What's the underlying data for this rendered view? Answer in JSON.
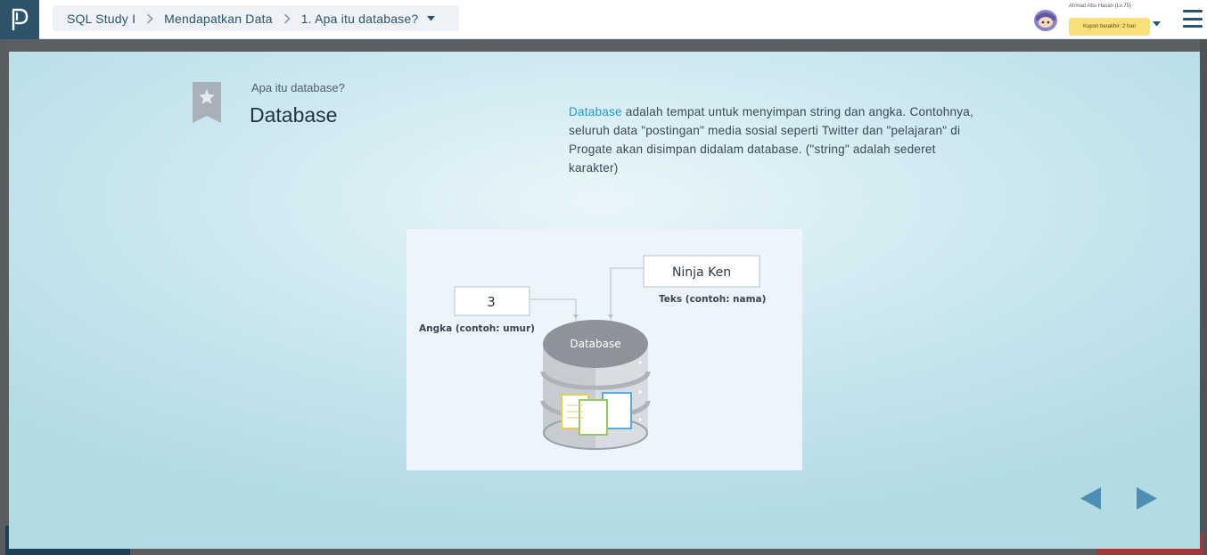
{
  "header": {
    "breadcrumb": [
      "SQL Study I",
      "Mendapatkan Data",
      "1. Apa itu database?"
    ],
    "user_name": "Ahmad Abu Hasan (Lv.75)",
    "coupon": "Kupon berakhir: 2 hari"
  },
  "slide": {
    "subtitle": "Apa itu database?",
    "title": "Database",
    "description_keyword": "Database",
    "description_rest": " adalah tempat untuk menyimpan string dan angka. Contohnya, seluruh data \"postingan\" media sosial seperti Twitter dan \"pelajaran\" di Progate akan disimpan didalam database. (\"string\" adalah sederet karakter)",
    "figure": {
      "number_value": "3",
      "number_label": "Angka (contoh: umur)",
      "text_value": "Ninja Ken",
      "text_label": "Teks (contoh: nama)",
      "db_label": "Database"
    }
  },
  "icons": {
    "logo": "progate-logo-icon",
    "chevron": "chevron-right-icon",
    "caret": "caret-down-icon",
    "menu": "hamburger-menu-icon",
    "bookmark": "bookmark-star-icon",
    "prev": "triangle-left-icon",
    "next": "triangle-right-icon"
  },
  "colors": {
    "brand_dark": "#2b546a",
    "keyword": "#1a9fc9",
    "nav_arrow": "#4d8fb3",
    "coupon_bg": "#f7e07a"
  }
}
